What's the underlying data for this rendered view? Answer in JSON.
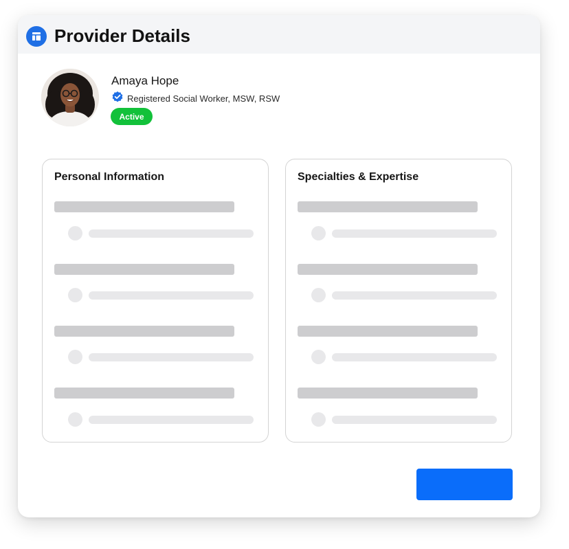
{
  "header": {
    "title": "Provider Details",
    "icon": "dashboard-icon",
    "accent_color": "#1f6fe5"
  },
  "provider": {
    "name": "Amaya Hope",
    "credentials": "Registered Social Worker, MSW, RSW",
    "verified_icon": "verified-badge-icon",
    "status": "Active",
    "status_color": "#12c13a"
  },
  "sections": {
    "personal_information": {
      "title": "Personal Information"
    },
    "specialties": {
      "title": "Specialties & Expertise"
    }
  },
  "primary_action": {
    "label": "",
    "color": "#0a6dfa"
  }
}
